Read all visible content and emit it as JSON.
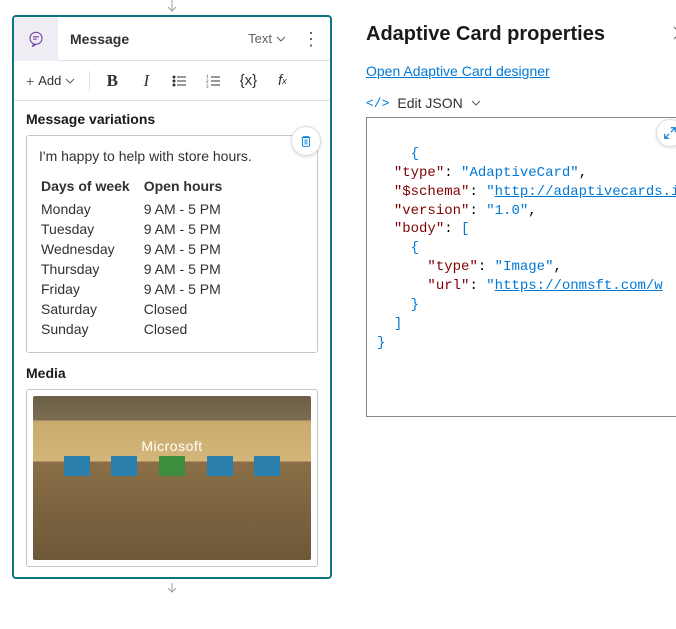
{
  "header": {
    "title": "Message",
    "mode": "Text"
  },
  "toolbar": {
    "add_label": "Add"
  },
  "sections": {
    "variations_title": "Message variations",
    "media_title": "Media"
  },
  "message": {
    "intro": "I'm happy to help with store hours.",
    "table": {
      "col1": "Days of week",
      "col2": "Open hours",
      "rows": [
        {
          "day": "Monday",
          "hours": "9 AM - 5 PM"
        },
        {
          "day": "Tuesday",
          "hours": "9 AM - 5 PM"
        },
        {
          "day": "Wednesday",
          "hours": "9 AM - 5 PM"
        },
        {
          "day": "Thursday",
          "hours": "9 AM - 5 PM"
        },
        {
          "day": "Friday",
          "hours": "9 AM - 5 PM"
        },
        {
          "day": "Saturday",
          "hours": "Closed"
        },
        {
          "day": "Sunday",
          "hours": "Closed"
        }
      ]
    }
  },
  "media": {
    "store_name": "Microsoft"
  },
  "properties": {
    "title": "Adaptive Card properties",
    "designer_link": "Open Adaptive Card designer",
    "edit_json_label": "Edit JSON"
  },
  "json_content": {
    "type_key": "type",
    "type_val": "AdaptiveCard",
    "schema_key": "$schema",
    "schema_val": "http://adaptivecards.i",
    "version_key": "version",
    "version_val": "1.0",
    "body_key": "body",
    "body_item_type_key": "type",
    "body_item_type_val": "Image",
    "body_item_url_key": "url",
    "body_item_url_val": "https://onmsft.com/w"
  }
}
